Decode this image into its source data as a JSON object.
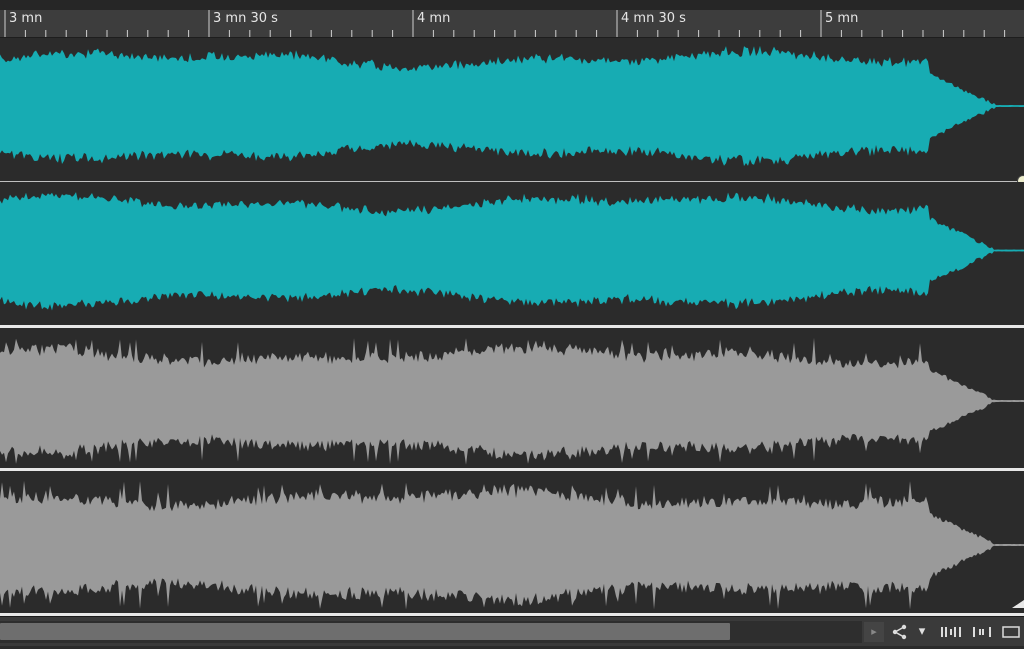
{
  "timeline": {
    "labels": [
      "3 mn",
      "3 mn 30 s",
      "4 mn",
      "4 mn 30 s",
      "5 mn"
    ]
  },
  "tracks": [
    {
      "name": "track-1-left",
      "color": "#17acb3"
    },
    {
      "name": "track-1-right",
      "color": "#17acb3"
    },
    {
      "name": "track-2-left",
      "color": "#9a9a9a"
    },
    {
      "name": "track-2-right",
      "color": "#9a9a9a"
    }
  ],
  "toolbar": {
    "scroll_left_icon": "play-right-triangle-icon",
    "share_icon": "share-icon",
    "dropdown_icon": "chevron-down-icon",
    "bars_icon_1": "waveform-bars-icon",
    "bars_icon_2": "waveform-bars-alt-icon",
    "window_icon": "window-icon",
    "share_glyph": "⋖",
    "dropdown_glyph": "▾",
    "bars_glyph_1": "ⅡⅠⅡⅠ",
    "bars_glyph_2": "ⅠⅡⅠ",
    "window_glyph": "▭",
    "arrow_glyph": "▸"
  }
}
